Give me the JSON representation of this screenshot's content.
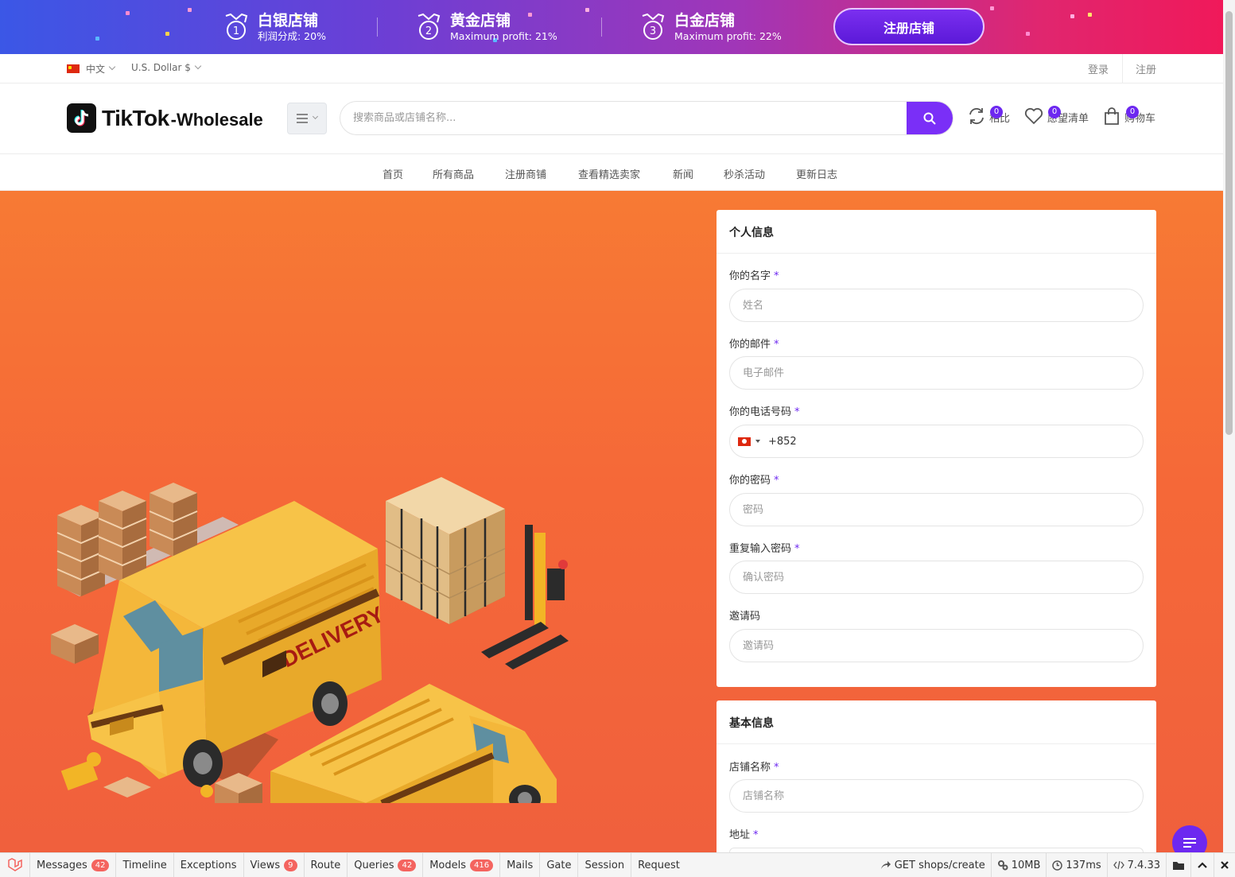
{
  "promo": {
    "tiers": [
      {
        "num": "1",
        "title": "白银店铺",
        "subtitle": "利润分成:  20%"
      },
      {
        "num": "2",
        "title": "黄金店铺",
        "subtitle": "Maximum profit: 21%"
      },
      {
        "num": "3",
        "title": "白金店铺",
        "subtitle": "Maximum profit: 22%"
      }
    ],
    "button_label": "注册店铺"
  },
  "topbar": {
    "language": "中文",
    "currency": "U.S. Dollar $",
    "login": "登录",
    "register": "注册"
  },
  "header": {
    "logo_main": "TikTok",
    "logo_sub": "-Wholesale",
    "search_placeholder": "搜索商品或店铺名称...",
    "compare": {
      "label": "相比",
      "count": "0"
    },
    "wishlist": {
      "label": "愿望清单",
      "count": "0"
    },
    "cart": {
      "label": "购物车",
      "count": "0"
    }
  },
  "nav": [
    "首页",
    "所有商品",
    "注册商铺",
    "查看精选卖家",
    "新闻",
    "秒杀活动",
    "更新日志"
  ],
  "hero": {
    "van_text": "DELIVERY"
  },
  "personal": {
    "title": "个人信息",
    "name": {
      "label": "你的名字",
      "placeholder": "姓名"
    },
    "email": {
      "label": "你的邮件",
      "placeholder": "电子邮件"
    },
    "phone": {
      "label": "你的电话号码",
      "value": "+852"
    },
    "password": {
      "label": "你的密码",
      "placeholder": "密码"
    },
    "confirm": {
      "label": "重复输入密码",
      "placeholder": "确认密码"
    },
    "invite": {
      "label": "邀请码",
      "placeholder": "邀请码"
    }
  },
  "basic": {
    "title": "基本信息",
    "shop_name": {
      "label": "店铺名称",
      "placeholder": "店铺名称"
    },
    "address": {
      "label": "地址"
    }
  },
  "required_mark": "*",
  "debugbar": {
    "tabs": [
      {
        "label": "Messages",
        "badge": "42"
      },
      {
        "label": "Timeline",
        "badge": ""
      },
      {
        "label": "Exceptions",
        "badge": ""
      },
      {
        "label": "Views",
        "badge": "9"
      },
      {
        "label": "Route",
        "badge": ""
      },
      {
        "label": "Queries",
        "badge": "42"
      },
      {
        "label": "Models",
        "badge": "416"
      },
      {
        "label": "Mails",
        "badge": ""
      },
      {
        "label": "Gate",
        "badge": ""
      },
      {
        "label": "Session",
        "badge": ""
      },
      {
        "label": "Request",
        "badge": ""
      }
    ],
    "route": "GET shops/create",
    "memory": "10MB",
    "time": "137ms",
    "php": "7.4.33"
  },
  "colors": {
    "accent": "#6d28f0",
    "hero": "#f56838",
    "badge": "#f4645f"
  },
  "icons": [
    "medal-icon",
    "search-icon",
    "sync-icon",
    "heart-icon",
    "bag-icon",
    "menu-icon",
    "chat-icon",
    "laravel-icon",
    "clock-icon",
    "folder-icon",
    "chevron-up-icon",
    "close-icon"
  ]
}
